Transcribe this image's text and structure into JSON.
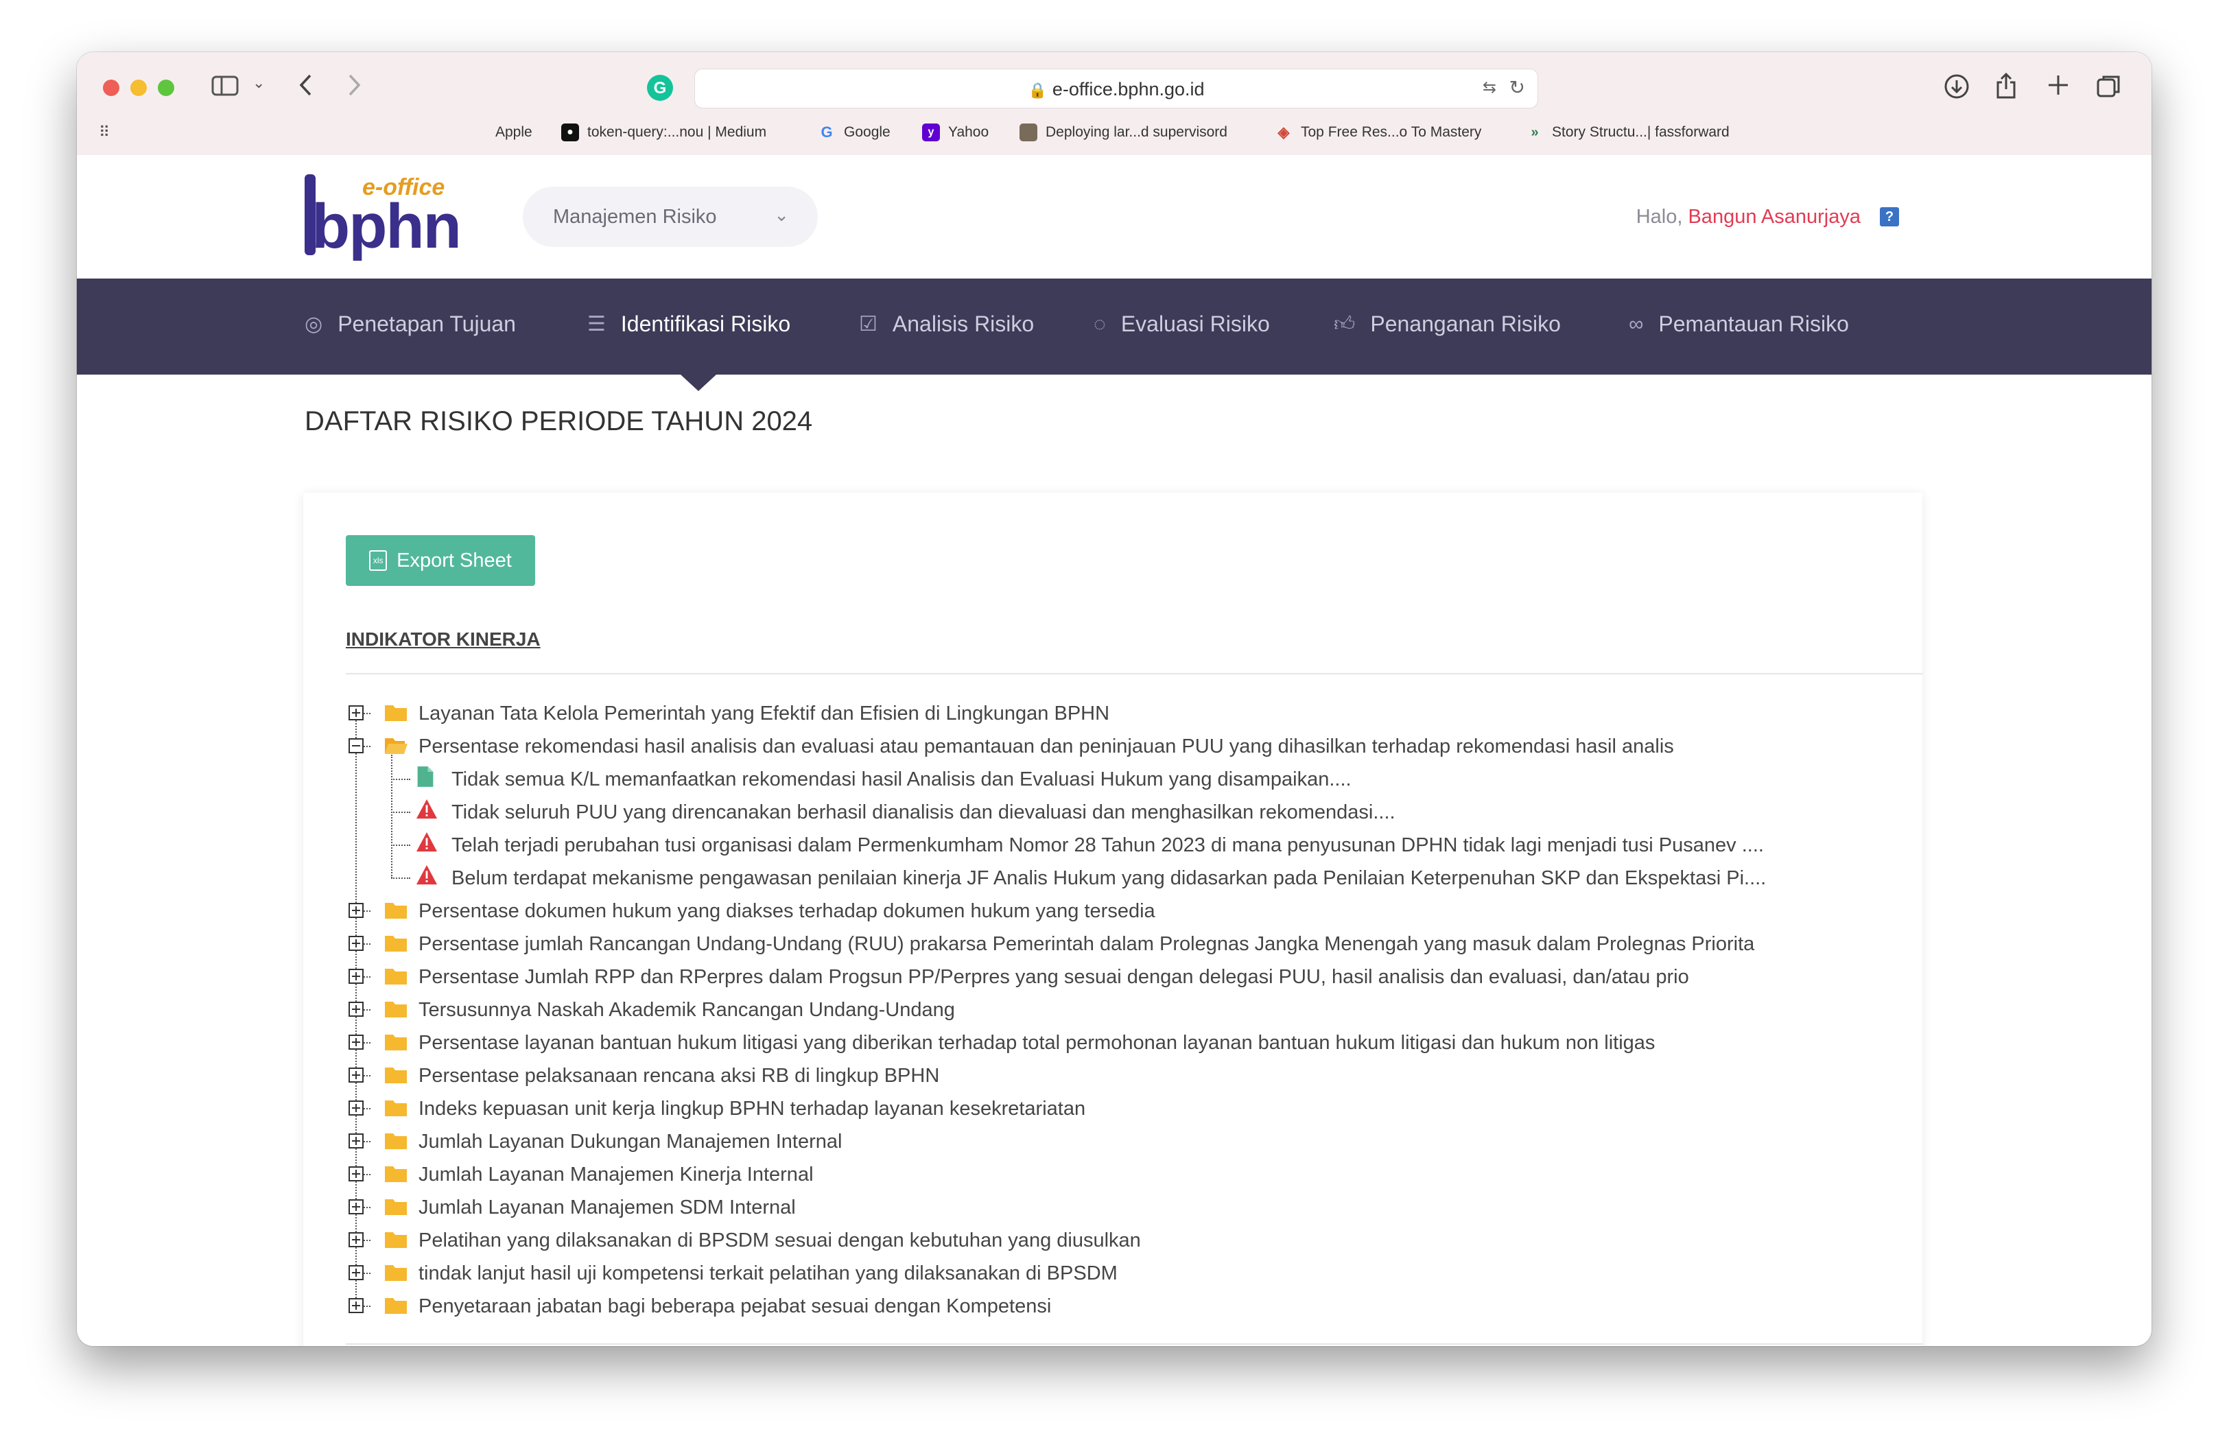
{
  "browser": {
    "url": "e-office.bphn.go.id",
    "bookmarks": [
      {
        "label": "Apple",
        "icon": "apple-icon",
        "color": "#222222"
      },
      {
        "label": "token-query:...nou | Medium",
        "icon": "medium-icon",
        "color": "#111111"
      },
      {
        "label": "Google",
        "icon": "google-icon",
        "color": "#4285f4"
      },
      {
        "label": "Yahoo",
        "icon": "yahoo-icon",
        "color": "#6001d2"
      },
      {
        "label": "Deploying lar...d supervisord",
        "icon": "avatar-icon",
        "color": "#7a6a5a"
      },
      {
        "label": "Top Free Res...o To Mastery",
        "icon": "layers-icon",
        "color": "#d14a3a"
      },
      {
        "label": "Story Structu...| fassforward",
        "icon": "chevrons-icon",
        "color": "#2e7d4f"
      }
    ]
  },
  "header": {
    "logo_top": "e-office",
    "logo_main": "bphn",
    "module": "Manajemen Risiko",
    "greeting": "Halo, ",
    "user_name": "Bangun Asanurjaya",
    "help_label": "?"
  },
  "nav": [
    {
      "label": "Penetapan Tujuan",
      "icon": "target-icon",
      "active": false
    },
    {
      "label": "Identifikasi Risiko",
      "icon": "list-check-icon",
      "active": true
    },
    {
      "label": "Analisis Risiko",
      "icon": "checkbox-icon",
      "active": false
    },
    {
      "label": "Evaluasi Risiko",
      "icon": "circle-notch-icon",
      "active": false
    },
    {
      "label": "Penanganan Risiko",
      "icon": "thumbs-up-icon",
      "active": false
    },
    {
      "label": "Pemantauan Risiko",
      "icon": "binoculars-icon",
      "active": false
    }
  ],
  "page": {
    "title": "DAFTAR RISIKO PERIODE TAHUN 2024",
    "export_label": "Export Sheet",
    "section_label": "INDIKATOR KINERJA"
  },
  "tree": [
    {
      "label": "Layanan Tata Kelola Pemerintah yang Efektif dan Efisien di Lingkungan BPHN",
      "expanded": false
    },
    {
      "label": "Persentase rekomendasi hasil analisis dan evaluasi atau pemantauan dan peninjauan PUU yang dihasilkan terhadap rekomendasi hasil analis",
      "expanded": true,
      "children": [
        {
          "label": "Tidak semua K/L memanfaatkan rekomendasi hasil Analisis dan Evaluasi Hukum yang disampaikan....",
          "icon": "document-icon"
        },
        {
          "label": "Tidak seluruh PUU yang direncanakan berhasil dianalisis dan dievaluasi dan menghasilkan rekomendasi....",
          "icon": "warning-icon"
        },
        {
          "label": "Telah terjadi perubahan tusi organisasi dalam Permenkumham Nomor 28 Tahun 2023 di mana penyusunan DPHN tidak lagi menjadi tusi Pusanev ....",
          "icon": "warning-icon"
        },
        {
          "label": "Belum terdapat mekanisme pengawasan penilaian kinerja JF Analis Hukum yang didasarkan pada Penilaian Keterpenuhan SKP dan Ekspektasi Pi....",
          "icon": "warning-icon"
        }
      ]
    },
    {
      "label": "Persentase dokumen hukum yang diakses terhadap dokumen hukum yang tersedia",
      "expanded": false
    },
    {
      "label": "Persentase jumlah Rancangan Undang-Undang (RUU) prakarsa Pemerintah dalam Prolegnas Jangka Menengah yang masuk dalam Prolegnas Priorita",
      "expanded": false
    },
    {
      "label": "Persentase Jumlah RPP dan RPerpres dalam Progsun PP/Perpres yang sesuai dengan delegasi PUU, hasil analisis dan evaluasi, dan/atau prio",
      "expanded": false
    },
    {
      "label": "Tersusunnya Naskah Akademik Rancangan Undang-Undang",
      "expanded": false
    },
    {
      "label": "Persentase layanan bantuan hukum litigasi yang diberikan terhadap total permohonan layanan bantuan hukum litigasi dan hukum non litigas",
      "expanded": false
    },
    {
      "label": "Persentase pelaksanaan rencana aksi RB di lingkup BPHN",
      "expanded": false
    },
    {
      "label": "Indeks kepuasan unit kerja lingkup BPHN terhadap layanan kesekretariatan",
      "expanded": false
    },
    {
      "label": "Jumlah Layanan Dukungan Manajemen Internal",
      "expanded": false
    },
    {
      "label": "Jumlah Layanan Manajemen Kinerja Internal",
      "expanded": false
    },
    {
      "label": "Jumlah Layanan Manajemen SDM Internal",
      "expanded": false
    },
    {
      "label": "Pelatihan yang dilaksanakan di BPSDM sesuai dengan kebutuhan yang diusulkan",
      "expanded": false
    },
    {
      "label": "tindak lanjut hasil uji kompetensi terkait pelatihan yang dilaksanakan di BPSDM",
      "expanded": false
    },
    {
      "label": "Penyetaraan jabatan bagi beberapa pejabat sesuai dengan Kompetensi",
      "expanded": false
    }
  ]
}
